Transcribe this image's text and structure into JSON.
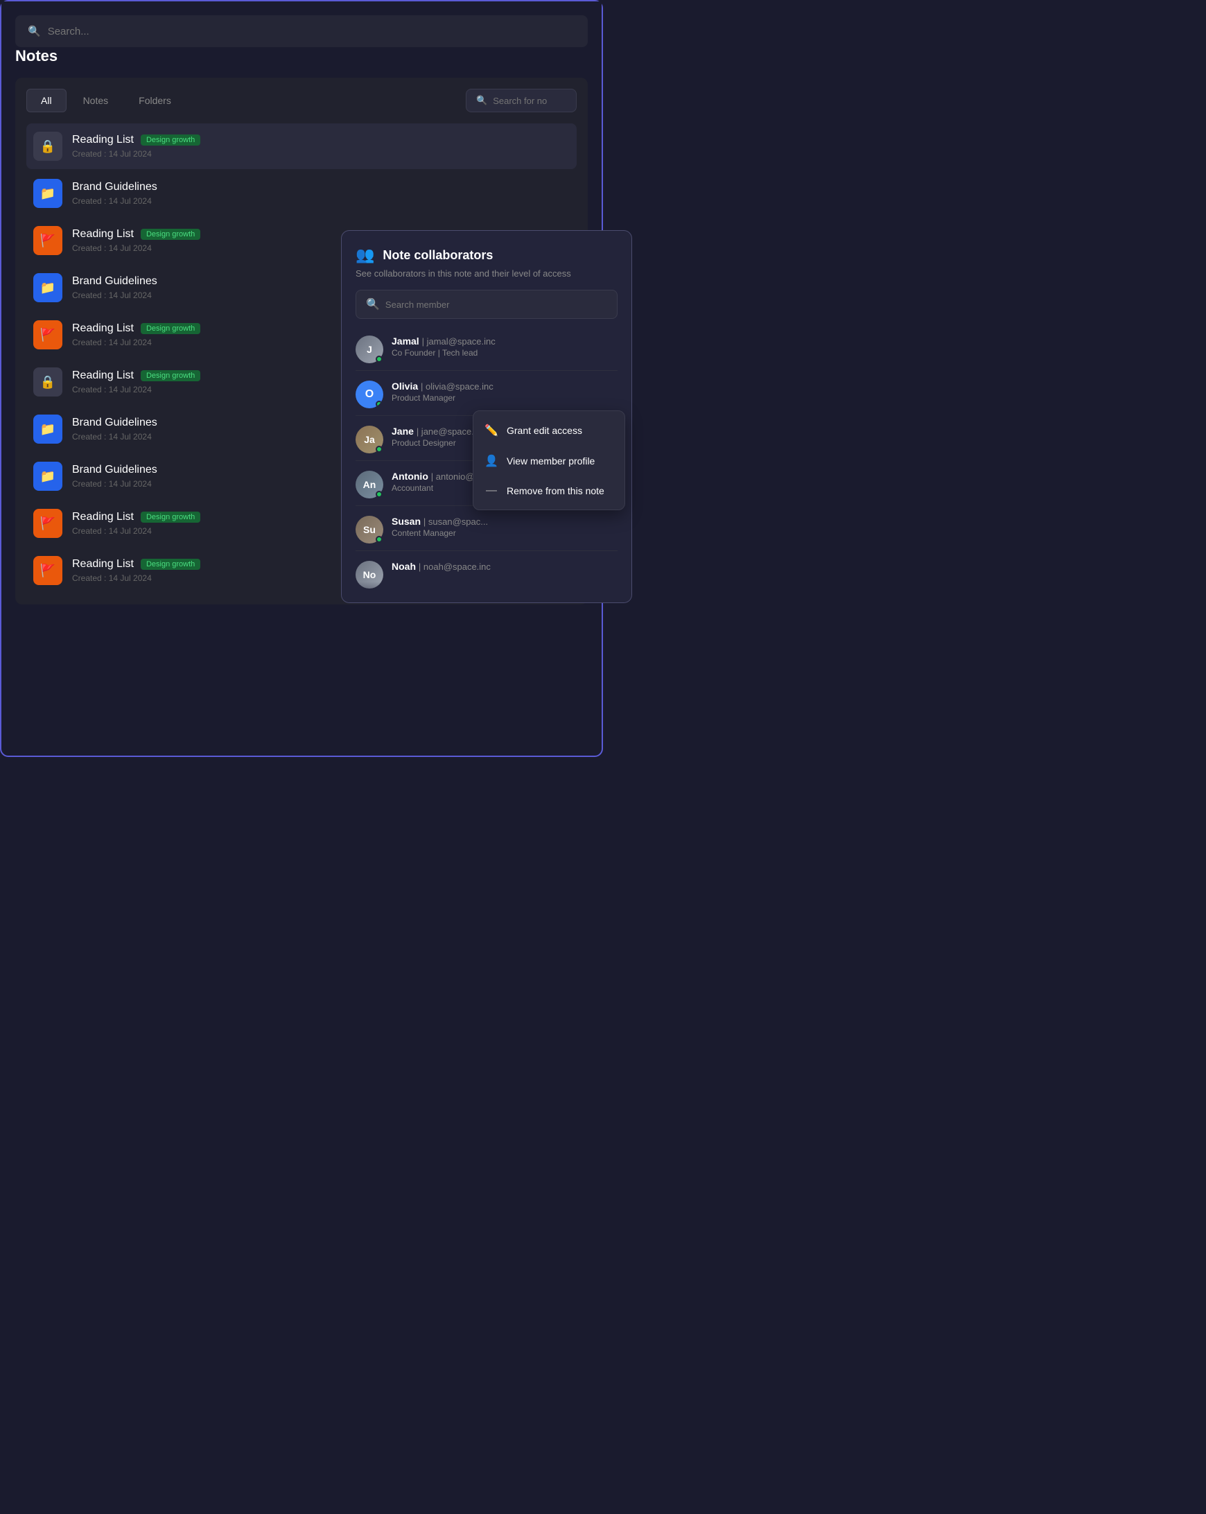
{
  "app": {
    "title": "Notes"
  },
  "search": {
    "placeholder": "Search...",
    "panelPlaceholder": "Search for no"
  },
  "tabs": [
    {
      "label": "All",
      "active": true
    },
    {
      "label": "Notes",
      "active": false
    },
    {
      "label": "Folders",
      "active": false
    }
  ],
  "notes": [
    {
      "id": 1,
      "type": "lock",
      "title": "Reading List",
      "tag": "Design growth",
      "date": "Created : 14 Jul 2024",
      "selected": true
    },
    {
      "id": 2,
      "type": "blue",
      "title": "Brand Guidelines",
      "tag": null,
      "date": "Created : 14 Jul 2024",
      "selected": false
    },
    {
      "id": 3,
      "type": "orange",
      "title": "Reading List",
      "tag": "Design growth",
      "date": "Created : 14 Jul 2024",
      "selected": false
    },
    {
      "id": 4,
      "type": "blue",
      "title": "Brand Guidelines",
      "tag": null,
      "date": "Created : 14 Jul 2024",
      "selected": false
    },
    {
      "id": 5,
      "type": "orange",
      "title": "Reading List",
      "tag": "Design growth",
      "date": "Created : 14 Jul 2024",
      "selected": false
    },
    {
      "id": 6,
      "type": "lock",
      "title": "Reading List",
      "tag": "Design growth",
      "date": "Created : 14 Jul 2024",
      "selected": false
    },
    {
      "id": 7,
      "type": "blue",
      "title": "Brand Guidelines",
      "tag": null,
      "date": "Created : 14 Jul 2024",
      "selected": false
    },
    {
      "id": 8,
      "type": "blue",
      "title": "Brand Guidelines",
      "tag": null,
      "date": "Created : 14 Jul 2024",
      "selected": false
    },
    {
      "id": 9,
      "type": "orange",
      "title": "Reading List",
      "tag": "Design growth",
      "date": "Created : 14 Jul 2024",
      "selected": false
    },
    {
      "id": 10,
      "type": "orange",
      "title": "Reading List",
      "tag": "Design growth",
      "date": "Created : 14 Jul 2024",
      "selected": false
    }
  ],
  "collaborators_panel": {
    "title": "Note collaborators",
    "subtitle": "See collaborators in this note and their level of access",
    "search_placeholder": "Search member",
    "members": [
      {
        "name": "Jamal",
        "email": "jamal@space.inc",
        "role": "Co Founder | Tech lead",
        "avatar_type": "img_jamal",
        "online": true
      },
      {
        "name": "Olivia",
        "email": "olivia@space.inc",
        "role": "Product Manager",
        "avatar_type": "initial_O",
        "online": true
      },
      {
        "name": "Jane",
        "email": "jane@space.inc",
        "role": "Product Designer",
        "avatar_type": "img_jane",
        "online": true
      },
      {
        "name": "Antonio",
        "email": "antonio@sp...",
        "role": "Accountant",
        "avatar_type": "img_antonio",
        "online": true
      },
      {
        "name": "Susan",
        "email": "susan@spac...",
        "role": "Content Manager",
        "avatar_type": "img_susan",
        "online": true
      },
      {
        "name": "Noah",
        "email": "noah@space.inc",
        "role": "",
        "avatar_type": "img_noah",
        "online": false
      }
    ]
  },
  "context_menu": {
    "items": [
      {
        "icon": "✏️",
        "label": "Grant edit access"
      },
      {
        "icon": "👤",
        "label": "View member profile"
      },
      {
        "icon": "—",
        "label": "Remove from this note"
      }
    ]
  }
}
